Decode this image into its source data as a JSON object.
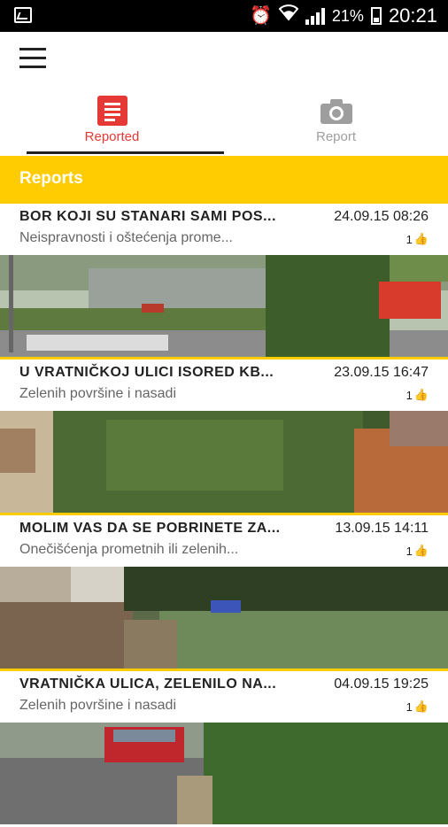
{
  "status_bar": {
    "battery": "21%",
    "time": "20:21"
  },
  "tabs": [
    {
      "label": "Reported",
      "icon": "list-icon",
      "active": true
    },
    {
      "label": "Report",
      "icon": "camera-icon",
      "active": false
    }
  ],
  "section": {
    "title": "Reports"
  },
  "colors": {
    "accent": "#fecc00",
    "active_tab": "#e53935"
  },
  "reports": [
    {
      "title": "BOR KOJI SU STANARI SAMI POS...",
      "date": "24.09.15 08:26",
      "category": "Neispravnosti i oštećenja prome...",
      "likes": "1"
    },
    {
      "title": "U VRATNIČKOJ ULICI ISORED KB...",
      "date": "23.09.15 16:47",
      "category": "Zelenih površine i nasadi",
      "likes": "1"
    },
    {
      "title": "MOLIM VAS DA SE POBRINETE ZA...",
      "date": "13.09.15 14:11",
      "category": "Onečišćenja prometnih ili zelenih...",
      "likes": "1"
    },
    {
      "title": "VRATNIČKA ULICA, ZELENILO NA...",
      "date": "04.09.15 19:25",
      "category": "Zelenih površine i nasadi",
      "likes": "1"
    }
  ]
}
